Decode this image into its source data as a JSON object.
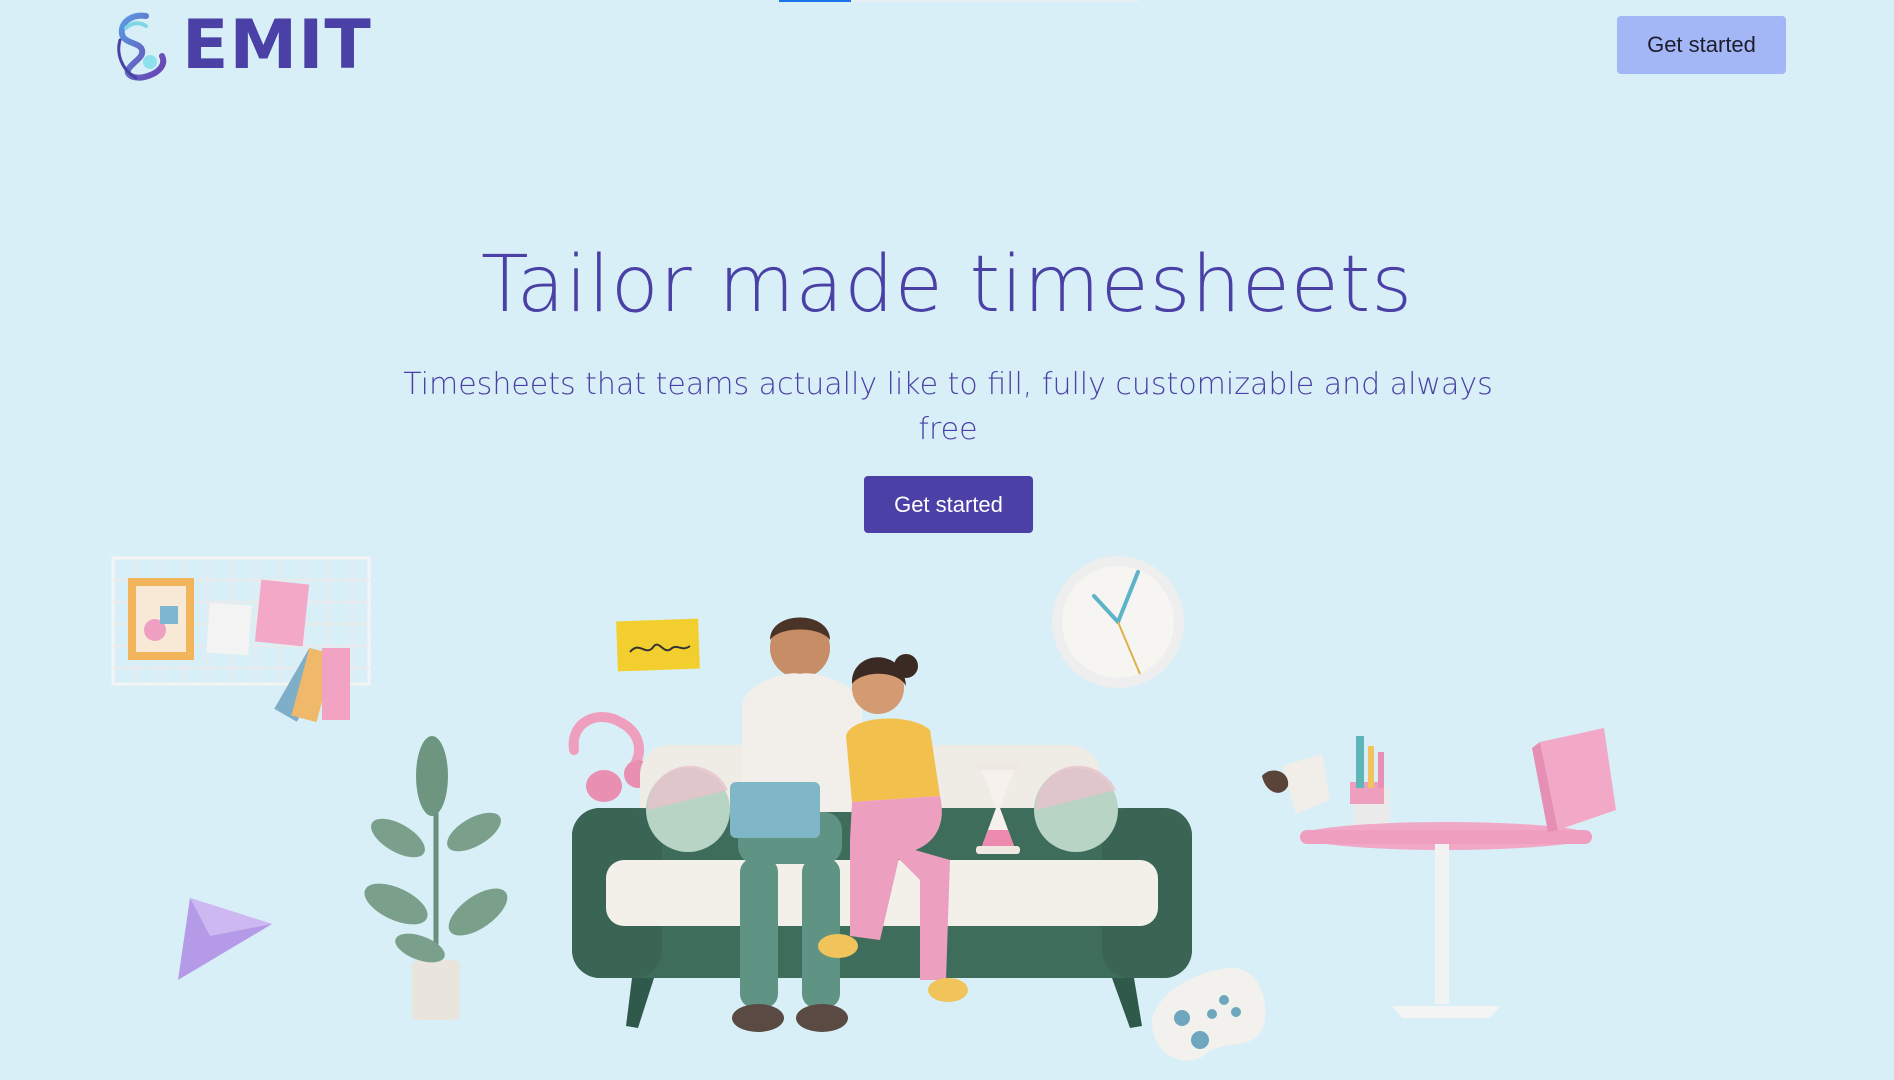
{
  "brand": {
    "name": "EMIT"
  },
  "header": {
    "cta_label": "Get started"
  },
  "hero": {
    "title": "Tailor made timesheets",
    "subtitle": "Timesheets that teams actually like to fill, fully customizable and always free",
    "cta_label": "Get started"
  },
  "colors": {
    "background": "#d8eff7",
    "brand": "#4a40a6",
    "header_button": "#a3b7f6",
    "hero_button": "#4a40a6"
  },
  "icons": {
    "logo": "emit-logo-icon",
    "illustration": "couple-on-sofa-illustration"
  }
}
